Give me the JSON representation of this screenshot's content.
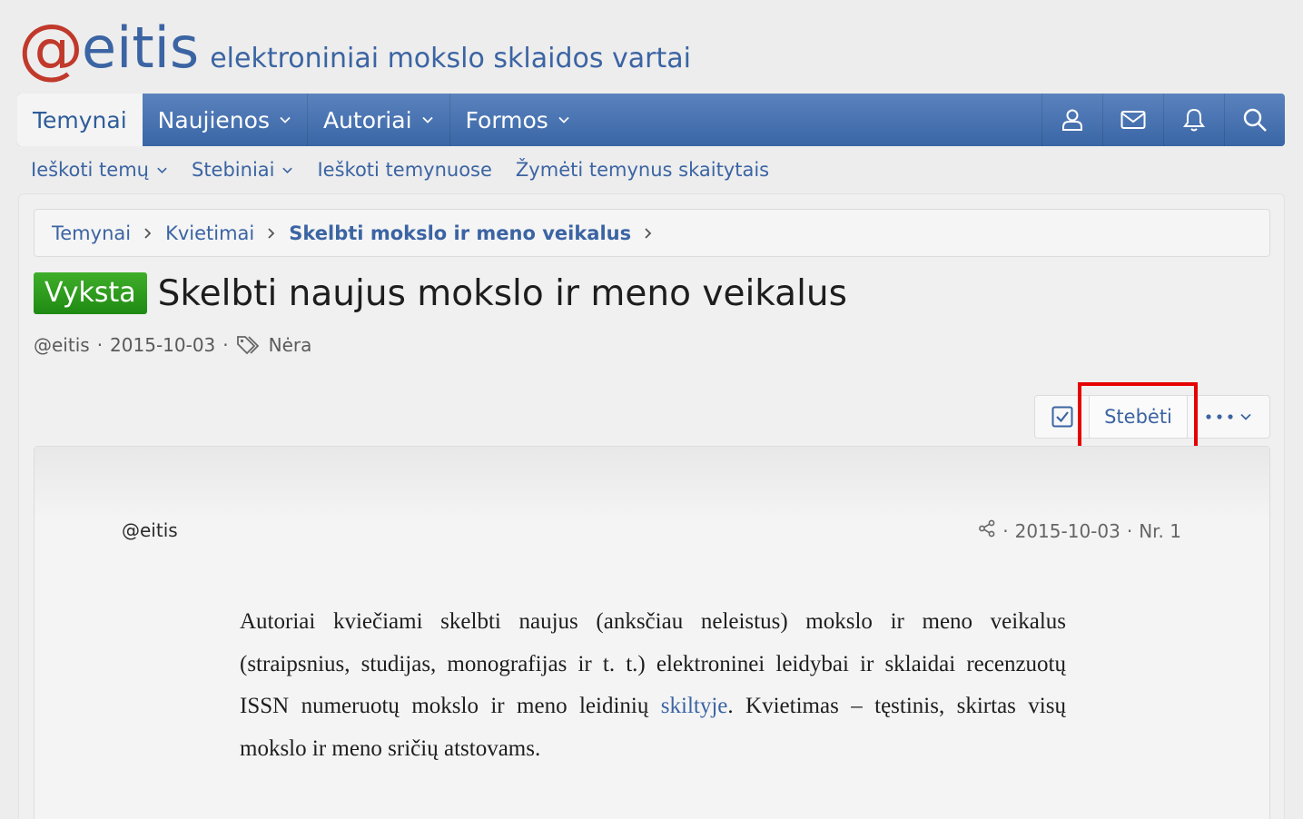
{
  "site": {
    "logo_at": "@",
    "logo_name": "eitis",
    "tagline": "elektroniniai mokslo sklaidos vartai"
  },
  "nav": {
    "tabs": [
      {
        "label": "Temynai"
      },
      {
        "label": "Naujienos"
      },
      {
        "label": "Autoriai"
      },
      {
        "label": "Formos"
      }
    ],
    "icons": [
      "user-icon",
      "mail-icon",
      "bell-icon",
      "search-icon"
    ]
  },
  "subnav": {
    "items": [
      {
        "label": "Ieškoti temų"
      },
      {
        "label": "Stebiniai"
      },
      {
        "label": "Ieškoti temynuose"
      },
      {
        "label": "Žymėti temynus skaitytais"
      }
    ]
  },
  "breadcrumb": {
    "items": [
      "Temynai",
      "Kvietimai",
      "Skelbti mokslo ir meno veikalus"
    ]
  },
  "thread": {
    "badge": "Vyksta",
    "title": "Skelbti naujus mokslo ir meno veikalus",
    "author": "@eitis",
    "date": "2015-10-03",
    "tags": "Nėra"
  },
  "actions": {
    "watch_label": "Stebėti"
  },
  "post": {
    "author": "@eitis",
    "date": "2015-10-03",
    "number": "Nr. 1",
    "body_before": "Autoriai kviečiami skelbti naujus (anksčiau neleistus) mokslo ir meno veikalus (straipsnius, studijas, monografijas ir t. t.) elektroninei leidybai ir sklaidai recenzuotų ISSN numeruotų mokslo ir meno leidinių ",
    "body_link": "skiltyje",
    "body_after": ". Kvietimas – tęstinis, skirtas visų mokslo ir meno sričių atstovams."
  },
  "colors": {
    "brand_blue": "#3b64a3",
    "logo_red": "#c0392b",
    "badge_green": "#2a9a1c",
    "highlight_red": "#e60000"
  }
}
